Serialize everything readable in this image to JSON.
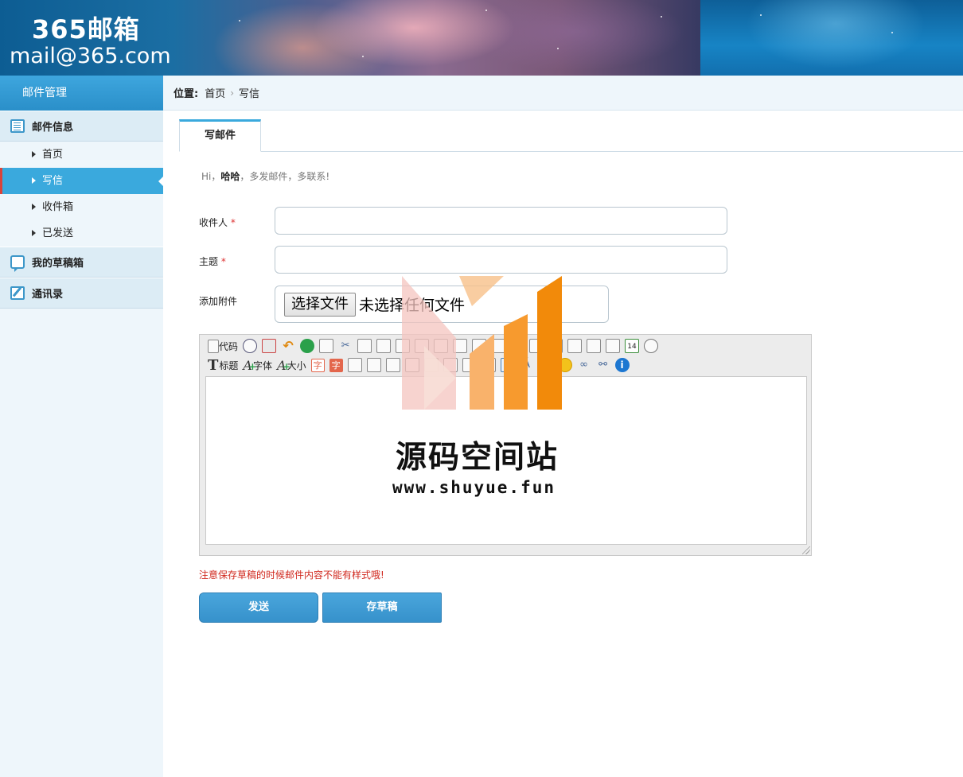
{
  "header": {
    "brand_title": "365邮箱",
    "brand_email": "mail@365.com"
  },
  "sidebar": {
    "title": "邮件管理",
    "groups": [
      {
        "label": "邮件信息",
        "icon": "list-icon",
        "items": [
          {
            "label": "首页"
          },
          {
            "label": "写信",
            "active": true
          },
          {
            "label": "收件箱"
          },
          {
            "label": "已发送"
          }
        ]
      },
      {
        "label": "我的草稿箱",
        "icon": "chat-icon"
      },
      {
        "label": "通讯录",
        "icon": "edit-icon"
      }
    ]
  },
  "breadcrumb": {
    "prefix": "位置:",
    "items": [
      "首页",
      "写信"
    ]
  },
  "tab": {
    "label": "写邮件"
  },
  "greeting": {
    "hi": "Hi，",
    "name": "哈哈",
    "rest": "，多发邮件，多联系!"
  },
  "form": {
    "recipient_label": "收件人",
    "subject_label": "主题",
    "attachment_label": "添加附件",
    "required_mark": "*",
    "recipient_value": "",
    "subject_value": "",
    "file_button": "选择文件",
    "file_status": "未选择任何文件"
  },
  "editor": {
    "toolbar_row1": {
      "code": "代码"
    },
    "toolbar_row2": {
      "heading": "标题",
      "font": "字体",
      "size": "大小",
      "zi": "字"
    }
  },
  "note": "注意保存草稿的时候邮件内容不能有样式哦!",
  "buttons": {
    "send": "发送",
    "draft": "存草稿"
  },
  "watermark": {
    "title": "源码空间站",
    "url": "www.shuyue.fun",
    "colors": [
      "#f7c9c3",
      "#f9b26b",
      "#f79a2e",
      "#f28a0a"
    ]
  },
  "colors": {
    "accent": "#3aa9dd",
    "active_marker": "#d9433a",
    "required": "#d33333",
    "note": "#d0281e"
  }
}
